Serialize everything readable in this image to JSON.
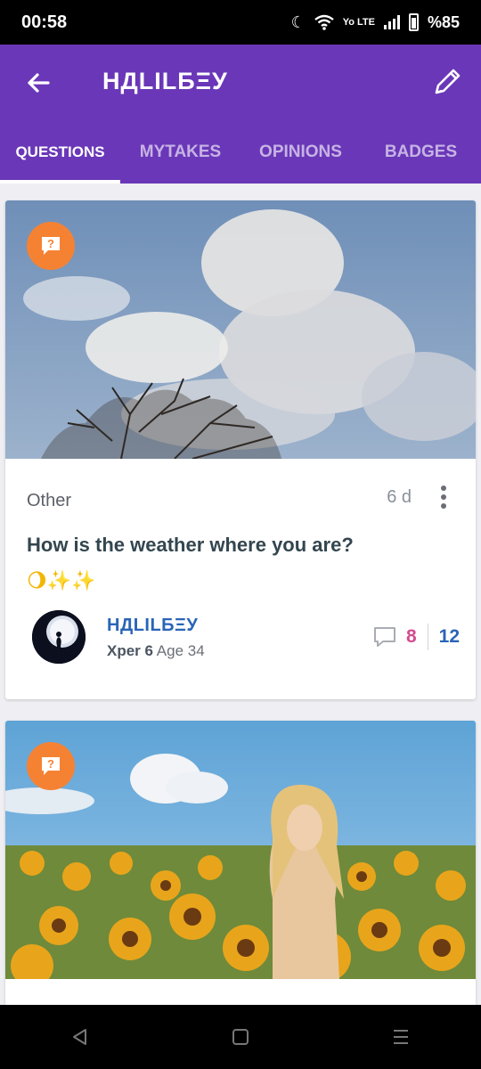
{
  "status_bar": {
    "time": "00:58",
    "battery": "%85",
    "network": "Yo LTE",
    "icons": [
      "moon-icon",
      "wifi-icon",
      "signal-icon",
      "battery-icon"
    ]
  },
  "app_bar": {
    "title": "НДLILБΞУ",
    "background": "#6a37b8",
    "back_icon": "back-arrow-icon",
    "edit_icon": "pencil-icon"
  },
  "tabs": [
    {
      "label": "QUESTIONS",
      "active": true
    },
    {
      "label": "MYTAKES",
      "active": false
    },
    {
      "label": "OPINIONS",
      "active": false
    },
    {
      "label": "BADGES",
      "active": false
    }
  ],
  "cards": [
    {
      "type_icon": "question-icon",
      "category": "Other",
      "age": "6 d",
      "title": "How is the weather where you are?",
      "emoji": "🌖✨✨",
      "author": {
        "name": "НДLILБΞУ",
        "level": "Xper 6",
        "age_text": "Age 34"
      },
      "comment_count": "8",
      "opinion_count": "12"
    },
    {
      "type_icon": "question-icon"
    }
  ],
  "colors": {
    "accent": "#6a37b8",
    "badge": "#f58233",
    "pink": "#d44b8f",
    "blue": "#2a64b8"
  }
}
